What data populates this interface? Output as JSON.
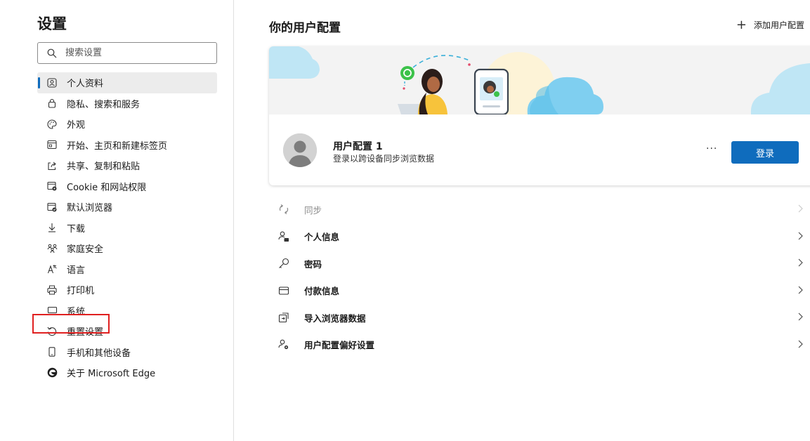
{
  "sidebar": {
    "title": "设置",
    "search_placeholder": "搜索设置",
    "items": [
      {
        "label": "个人资料",
        "icon": "profile-icon"
      },
      {
        "label": "隐私、搜索和服务",
        "icon": "lock-icon"
      },
      {
        "label": "外观",
        "icon": "palette-icon"
      },
      {
        "label": "开始、主页和新建标签页",
        "icon": "home-tab-icon"
      },
      {
        "label": "共享、复制和粘贴",
        "icon": "share-icon"
      },
      {
        "label": "Cookie 和网站权限",
        "icon": "site-permissions-icon"
      },
      {
        "label": "默认浏览器",
        "icon": "default-browser-icon"
      },
      {
        "label": "下载",
        "icon": "download-icon"
      },
      {
        "label": "家庭安全",
        "icon": "family-icon"
      },
      {
        "label": "语言",
        "icon": "language-icon"
      },
      {
        "label": "打印机",
        "icon": "printer-icon"
      },
      {
        "label": "系统",
        "icon": "system-icon"
      },
      {
        "label": "重置设置",
        "icon": "reset-icon"
      },
      {
        "label": "手机和其他设备",
        "icon": "phone-icon"
      },
      {
        "label": "关于 Microsoft Edge",
        "icon": "edge-logo-icon"
      }
    ]
  },
  "main": {
    "title": "你的用户配置",
    "add_profile_label": "添加用户配置",
    "profile": {
      "name": "用户配置 1",
      "subtitle": "登录以跨设备同步浏览数据",
      "more_label": "···",
      "signin_label": "登录"
    },
    "options": [
      {
        "label": "同步",
        "icon": "sync-icon",
        "disabled": true
      },
      {
        "label": "个人信息",
        "icon": "personal-info-icon",
        "disabled": false
      },
      {
        "label": "密码",
        "icon": "key-icon",
        "disabled": false
      },
      {
        "label": "付款信息",
        "icon": "credit-card-icon",
        "disabled": false
      },
      {
        "label": "导入浏览器数据",
        "icon": "import-icon",
        "disabled": false
      },
      {
        "label": "用户配置偏好设置",
        "icon": "profile-preferences-icon",
        "disabled": false
      }
    ]
  },
  "colors": {
    "accent": "#0f6cbd",
    "highlight_box": "#e02020",
    "cloud": "#bfe6f5"
  }
}
